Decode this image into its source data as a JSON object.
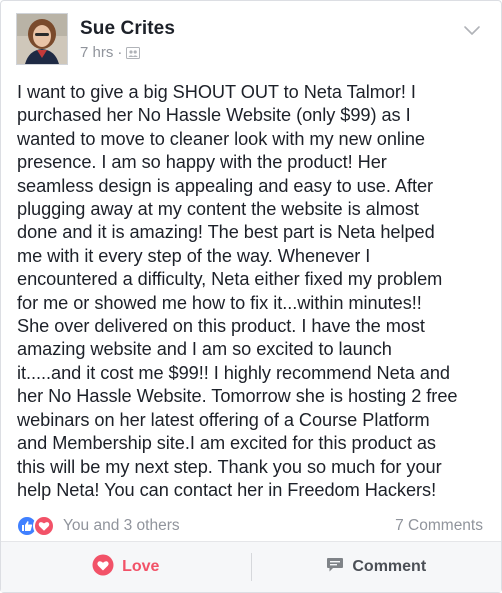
{
  "post": {
    "author": "Sue Crites",
    "time": "7 hrs",
    "separator": "·",
    "body": "I want to give a big SHOUT OUT to Neta Talmor! I\npurchased her No Hassle Website (only $99) as I\nwanted to move to cleaner look with my new online\npresence. I am so happy with the product! Her\nseamless design is appealing and easy to use. After\nplugging away at my content the website is almost\ndone and it is amazing! The best part is Neta helped\nme with it every step of the way. Whenever I\nencountered a difficulty, Neta either fixed my problem\nfor me or showed me how to fix it...within minutes!!\nShe over delivered on this product. I have the most\namazing website and I am so excited to launch\nit.....and it cost me $99!! I highly recommend Neta and\nher No Hassle Website. Tomorrow she is hosting 2 free\nwebinars on her latest offering of a Course Platform\nand Membership site.I am excited for this product as\nthis will be my next step. Thank you so much for your\nhelp Neta! You can contact her in Freedom Hackers!"
  },
  "reactions": {
    "summary": "You and 3 others",
    "comments": "7 Comments",
    "like_color": "#4080ff",
    "love_color": "#f25268"
  },
  "actions": {
    "love_label": "Love",
    "comment_label": "Comment"
  },
  "icons": {
    "audience": "friends-icon",
    "menu": "chevron-down-icon",
    "love": "heart-icon",
    "comment": "comment-icon"
  }
}
